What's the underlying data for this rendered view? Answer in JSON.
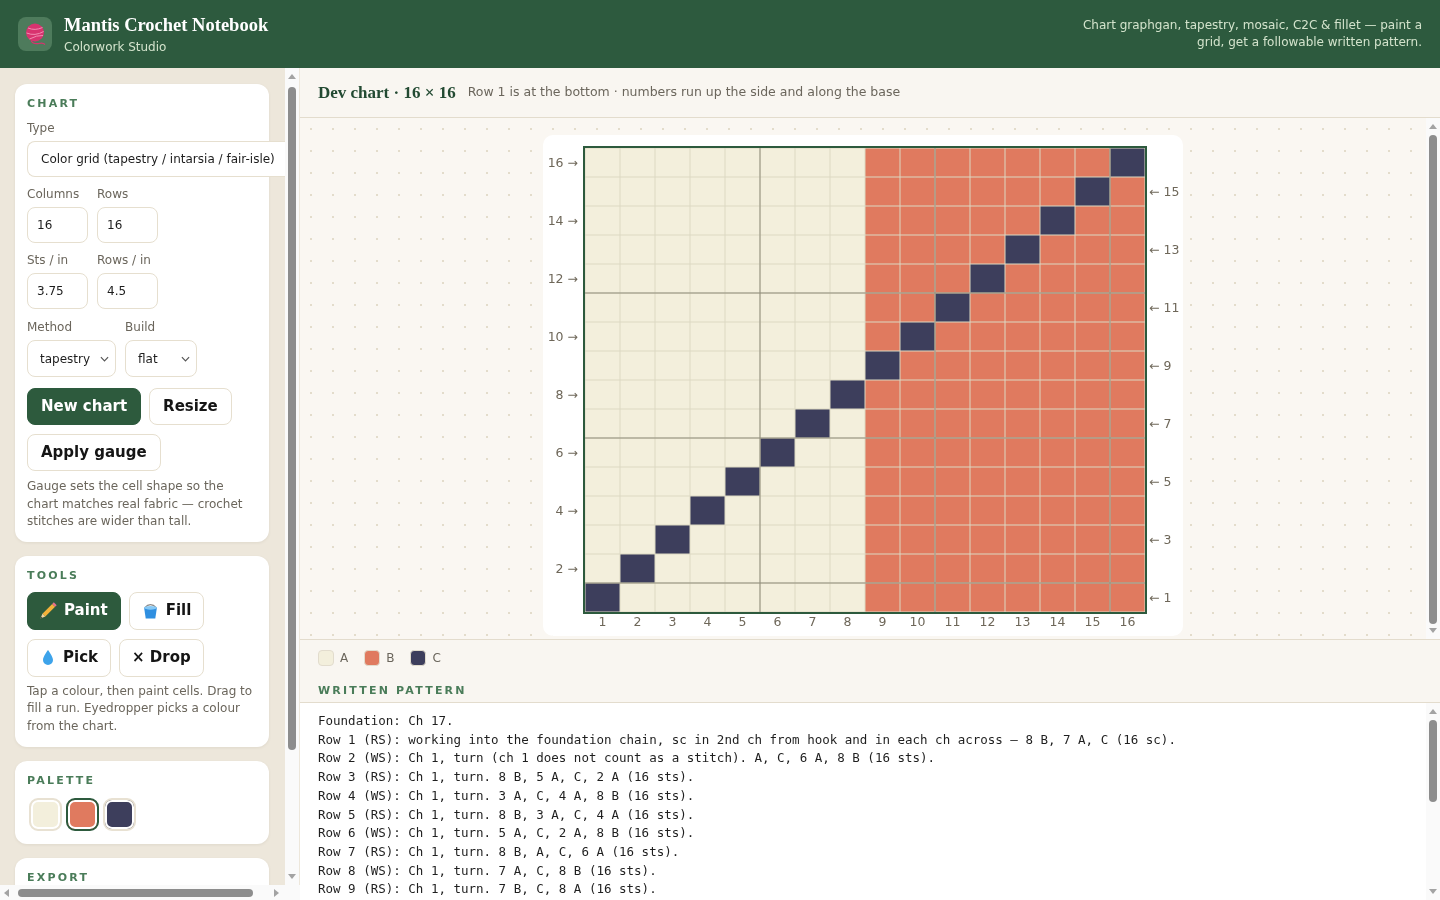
{
  "header": {
    "title": "Mantis Crochet Notebook",
    "subtitle": "Colorwork Studio",
    "tagline": "Chart graphgan, tapestry, mosaic, C2C & fillet — paint a grid, get a followable written pattern."
  },
  "sidebar": {
    "chart_panel": {
      "heading": "CHART",
      "type_field": {
        "label": "Type",
        "value": "Color grid (tapestry / intarsia / fair-isle)"
      },
      "size_fields": [
        {
          "label": "Columns",
          "value": "16"
        },
        {
          "label": "Rows",
          "value": "16"
        }
      ],
      "gauge_fields": [
        {
          "label": "Sts / in",
          "value": "3.75"
        },
        {
          "label": "Rows / in",
          "value": "4.5"
        }
      ],
      "dropdowns": [
        {
          "label": "Method",
          "value": "tapestry"
        },
        {
          "label": "Build",
          "value": "flat"
        }
      ],
      "buttons": [
        {
          "label": "New chart",
          "kind": "primary"
        },
        {
          "label": "Resize",
          "kind": "secondary"
        },
        {
          "label": "Apply gauge",
          "kind": "secondary"
        }
      ],
      "note": "Gauge sets the cell shape so the chart matches real fabric — crochet stitches are wider than tall."
    },
    "tools_panel": {
      "heading": "TOOLS",
      "tools": [
        {
          "kind": "paint",
          "label": "Paint",
          "selected": true
        },
        {
          "kind": "fill",
          "label": "Fill",
          "selected": false
        },
        {
          "kind": "pick",
          "label": "Pick",
          "selected": false
        },
        {
          "kind": "drop",
          "label": "× Drop",
          "selected": false
        }
      ],
      "note": "Tap a colour, then paint cells. Drag to fill a run. Eyedropper picks a colour from the chart."
    },
    "palette_panel": {
      "heading": "PALETTE",
      "swatches": [
        {
          "color": "#f3efdc",
          "selected": false
        },
        {
          "color": "#e07a5f",
          "selected": true
        },
        {
          "color": "#3d3e5c",
          "selected": false
        }
      ]
    },
    "export_panel": {
      "heading": "EXPORT"
    }
  },
  "chart": {
    "title": "Dev chart · 16 × 16",
    "subtitle": "Row 1 is at the bottom · numbers run up the side and along the base",
    "rows": [
      {
        "label": "16 →",
        "kind": "left",
        "cells": [
          {
            "color": "#f3efdc"
          },
          {
            "color": "#f3efdc"
          },
          {
            "color": "#f3efdc"
          },
          {
            "color": "#f3efdc"
          },
          {
            "color": "#f3efdc"
          },
          {
            "color": "#f3efdc"
          },
          {
            "color": "#f3efdc"
          },
          {
            "color": "#f3efdc"
          },
          {
            "color": "#e07a5f"
          },
          {
            "color": "#e07a5f"
          },
          {
            "color": "#e07a5f"
          },
          {
            "color": "#e07a5f"
          },
          {
            "color": "#e07a5f"
          },
          {
            "color": "#e07a5f"
          },
          {
            "color": "#e07a5f"
          },
          {
            "color": "#3d3e5c"
          }
        ]
      },
      {
        "label": "← 15",
        "kind": "right",
        "cells": [
          {
            "color": "#f3efdc"
          },
          {
            "color": "#f3efdc"
          },
          {
            "color": "#f3efdc"
          },
          {
            "color": "#f3efdc"
          },
          {
            "color": "#f3efdc"
          },
          {
            "color": "#f3efdc"
          },
          {
            "color": "#f3efdc"
          },
          {
            "color": "#f3efdc"
          },
          {
            "color": "#e07a5f"
          },
          {
            "color": "#e07a5f"
          },
          {
            "color": "#e07a5f"
          },
          {
            "color": "#e07a5f"
          },
          {
            "color": "#e07a5f"
          },
          {
            "color": "#e07a5f"
          },
          {
            "color": "#3d3e5c"
          },
          {
            "color": "#e07a5f"
          }
        ]
      },
      {
        "label": "14 →",
        "kind": "left",
        "cells": [
          {
            "color": "#f3efdc"
          },
          {
            "color": "#f3efdc"
          },
          {
            "color": "#f3efdc"
          },
          {
            "color": "#f3efdc"
          },
          {
            "color": "#f3efdc"
          },
          {
            "color": "#f3efdc"
          },
          {
            "color": "#f3efdc"
          },
          {
            "color": "#f3efdc"
          },
          {
            "color": "#e07a5f"
          },
          {
            "color": "#e07a5f"
          },
          {
            "color": "#e07a5f"
          },
          {
            "color": "#e07a5f"
          },
          {
            "color": "#e07a5f"
          },
          {
            "color": "#3d3e5c"
          },
          {
            "color": "#e07a5f"
          },
          {
            "color": "#e07a5f"
          }
        ]
      },
      {
        "label": "← 13",
        "kind": "right",
        "cells": [
          {
            "color": "#f3efdc"
          },
          {
            "color": "#f3efdc"
          },
          {
            "color": "#f3efdc"
          },
          {
            "color": "#f3efdc"
          },
          {
            "color": "#f3efdc"
          },
          {
            "color": "#f3efdc"
          },
          {
            "color": "#f3efdc"
          },
          {
            "color": "#f3efdc"
          },
          {
            "color": "#e07a5f"
          },
          {
            "color": "#e07a5f"
          },
          {
            "color": "#e07a5f"
          },
          {
            "color": "#e07a5f"
          },
          {
            "color": "#3d3e5c"
          },
          {
            "color": "#e07a5f"
          },
          {
            "color": "#e07a5f"
          },
          {
            "color": "#e07a5f"
          }
        ]
      },
      {
        "label": "12 →",
        "kind": "left",
        "cells": [
          {
            "color": "#f3efdc"
          },
          {
            "color": "#f3efdc"
          },
          {
            "color": "#f3efdc"
          },
          {
            "color": "#f3efdc"
          },
          {
            "color": "#f3efdc"
          },
          {
            "color": "#f3efdc"
          },
          {
            "color": "#f3efdc"
          },
          {
            "color": "#f3efdc"
          },
          {
            "color": "#e07a5f"
          },
          {
            "color": "#e07a5f"
          },
          {
            "color": "#e07a5f"
          },
          {
            "color": "#3d3e5c"
          },
          {
            "color": "#e07a5f"
          },
          {
            "color": "#e07a5f"
          },
          {
            "color": "#e07a5f"
          },
          {
            "color": "#e07a5f"
          }
        ]
      },
      {
        "label": "← 11",
        "kind": "right",
        "cells": [
          {
            "color": "#f3efdc"
          },
          {
            "color": "#f3efdc"
          },
          {
            "color": "#f3efdc"
          },
          {
            "color": "#f3efdc"
          },
          {
            "color": "#f3efdc"
          },
          {
            "color": "#f3efdc"
          },
          {
            "color": "#f3efdc"
          },
          {
            "color": "#f3efdc"
          },
          {
            "color": "#e07a5f"
          },
          {
            "color": "#e07a5f"
          },
          {
            "color": "#3d3e5c"
          },
          {
            "color": "#e07a5f"
          },
          {
            "color": "#e07a5f"
          },
          {
            "color": "#e07a5f"
          },
          {
            "color": "#e07a5f"
          },
          {
            "color": "#e07a5f"
          }
        ]
      },
      {
        "label": "10 →",
        "kind": "left",
        "cells": [
          {
            "color": "#f3efdc"
          },
          {
            "color": "#f3efdc"
          },
          {
            "color": "#f3efdc"
          },
          {
            "color": "#f3efdc"
          },
          {
            "color": "#f3efdc"
          },
          {
            "color": "#f3efdc"
          },
          {
            "color": "#f3efdc"
          },
          {
            "color": "#f3efdc"
          },
          {
            "color": "#e07a5f"
          },
          {
            "color": "#3d3e5c"
          },
          {
            "color": "#e07a5f"
          },
          {
            "color": "#e07a5f"
          },
          {
            "color": "#e07a5f"
          },
          {
            "color": "#e07a5f"
          },
          {
            "color": "#e07a5f"
          },
          {
            "color": "#e07a5f"
          }
        ]
      },
      {
        "label": "← 9",
        "kind": "right",
        "cells": [
          {
            "color": "#f3efdc"
          },
          {
            "color": "#f3efdc"
          },
          {
            "color": "#f3efdc"
          },
          {
            "color": "#f3efdc"
          },
          {
            "color": "#f3efdc"
          },
          {
            "color": "#f3efdc"
          },
          {
            "color": "#f3efdc"
          },
          {
            "color": "#f3efdc"
          },
          {
            "color": "#3d3e5c"
          },
          {
            "color": "#e07a5f"
          },
          {
            "color": "#e07a5f"
          },
          {
            "color": "#e07a5f"
          },
          {
            "color": "#e07a5f"
          },
          {
            "color": "#e07a5f"
          },
          {
            "color": "#e07a5f"
          },
          {
            "color": "#e07a5f"
          }
        ]
      },
      {
        "label": "8 →",
        "kind": "left",
        "cells": [
          {
            "color": "#f3efdc"
          },
          {
            "color": "#f3efdc"
          },
          {
            "color": "#f3efdc"
          },
          {
            "color": "#f3efdc"
          },
          {
            "color": "#f3efdc"
          },
          {
            "color": "#f3efdc"
          },
          {
            "color": "#f3efdc"
          },
          {
            "color": "#3d3e5c"
          },
          {
            "color": "#e07a5f"
          },
          {
            "color": "#e07a5f"
          },
          {
            "color": "#e07a5f"
          },
          {
            "color": "#e07a5f"
          },
          {
            "color": "#e07a5f"
          },
          {
            "color": "#e07a5f"
          },
          {
            "color": "#e07a5f"
          },
          {
            "color": "#e07a5f"
          }
        ]
      },
      {
        "label": "← 7",
        "kind": "right",
        "cells": [
          {
            "color": "#f3efdc"
          },
          {
            "color": "#f3efdc"
          },
          {
            "color": "#f3efdc"
          },
          {
            "color": "#f3efdc"
          },
          {
            "color": "#f3efdc"
          },
          {
            "color": "#f3efdc"
          },
          {
            "color": "#3d3e5c"
          },
          {
            "color": "#f3efdc"
          },
          {
            "color": "#e07a5f"
          },
          {
            "color": "#e07a5f"
          },
          {
            "color": "#e07a5f"
          },
          {
            "color": "#e07a5f"
          },
          {
            "color": "#e07a5f"
          },
          {
            "color": "#e07a5f"
          },
          {
            "color": "#e07a5f"
          },
          {
            "color": "#e07a5f"
          }
        ]
      },
      {
        "label": "6 →",
        "kind": "left",
        "cells": [
          {
            "color": "#f3efdc"
          },
          {
            "color": "#f3efdc"
          },
          {
            "color": "#f3efdc"
          },
          {
            "color": "#f3efdc"
          },
          {
            "color": "#f3efdc"
          },
          {
            "color": "#3d3e5c"
          },
          {
            "color": "#f3efdc"
          },
          {
            "color": "#f3efdc"
          },
          {
            "color": "#e07a5f"
          },
          {
            "color": "#e07a5f"
          },
          {
            "color": "#e07a5f"
          },
          {
            "color": "#e07a5f"
          },
          {
            "color": "#e07a5f"
          },
          {
            "color": "#e07a5f"
          },
          {
            "color": "#e07a5f"
          },
          {
            "color": "#e07a5f"
          }
        ]
      },
      {
        "label": "← 5",
        "kind": "right",
        "cells": [
          {
            "color": "#f3efdc"
          },
          {
            "color": "#f3efdc"
          },
          {
            "color": "#f3efdc"
          },
          {
            "color": "#f3efdc"
          },
          {
            "color": "#3d3e5c"
          },
          {
            "color": "#f3efdc"
          },
          {
            "color": "#f3efdc"
          },
          {
            "color": "#f3efdc"
          },
          {
            "color": "#e07a5f"
          },
          {
            "color": "#e07a5f"
          },
          {
            "color": "#e07a5f"
          },
          {
            "color": "#e07a5f"
          },
          {
            "color": "#e07a5f"
          },
          {
            "color": "#e07a5f"
          },
          {
            "color": "#e07a5f"
          },
          {
            "color": "#e07a5f"
          }
        ]
      },
      {
        "label": "4 →",
        "kind": "left",
        "cells": [
          {
            "color": "#f3efdc"
          },
          {
            "color": "#f3efdc"
          },
          {
            "color": "#f3efdc"
          },
          {
            "color": "#3d3e5c"
          },
          {
            "color": "#f3efdc"
          },
          {
            "color": "#f3efdc"
          },
          {
            "color": "#f3efdc"
          },
          {
            "color": "#f3efdc"
          },
          {
            "color": "#e07a5f"
          },
          {
            "color": "#e07a5f"
          },
          {
            "color": "#e07a5f"
          },
          {
            "color": "#e07a5f"
          },
          {
            "color": "#e07a5f"
          },
          {
            "color": "#e07a5f"
          },
          {
            "color": "#e07a5f"
          },
          {
            "color": "#e07a5f"
          }
        ]
      },
      {
        "label": "← 3",
        "kind": "right",
        "cells": [
          {
            "color": "#f3efdc"
          },
          {
            "color": "#f3efdc"
          },
          {
            "color": "#3d3e5c"
          },
          {
            "color": "#f3efdc"
          },
          {
            "color": "#f3efdc"
          },
          {
            "color": "#f3efdc"
          },
          {
            "color": "#f3efdc"
          },
          {
            "color": "#f3efdc"
          },
          {
            "color": "#e07a5f"
          },
          {
            "color": "#e07a5f"
          },
          {
            "color": "#e07a5f"
          },
          {
            "color": "#e07a5f"
          },
          {
            "color": "#e07a5f"
          },
          {
            "color": "#e07a5f"
          },
          {
            "color": "#e07a5f"
          },
          {
            "color": "#e07a5f"
          }
        ]
      },
      {
        "label": "2 →",
        "kind": "left",
        "cells": [
          {
            "color": "#f3efdc"
          },
          {
            "color": "#3d3e5c"
          },
          {
            "color": "#f3efdc"
          },
          {
            "color": "#f3efdc"
          },
          {
            "color": "#f3efdc"
          },
          {
            "color": "#f3efdc"
          },
          {
            "color": "#f3efdc"
          },
          {
            "color": "#f3efdc"
          },
          {
            "color": "#e07a5f"
          },
          {
            "color": "#e07a5f"
          },
          {
            "color": "#e07a5f"
          },
          {
            "color": "#e07a5f"
          },
          {
            "color": "#e07a5f"
          },
          {
            "color": "#e07a5f"
          },
          {
            "color": "#e07a5f"
          },
          {
            "color": "#e07a5f"
          }
        ]
      },
      {
        "label": "← 1",
        "kind": "right",
        "cells": [
          {
            "color": "#3d3e5c"
          },
          {
            "color": "#f3efdc"
          },
          {
            "color": "#f3efdc"
          },
          {
            "color": "#f3efdc"
          },
          {
            "color": "#f3efdc"
          },
          {
            "color": "#f3efdc"
          },
          {
            "color": "#f3efdc"
          },
          {
            "color": "#f3efdc"
          },
          {
            "color": "#e07a5f"
          },
          {
            "color": "#e07a5f"
          },
          {
            "color": "#e07a5f"
          },
          {
            "color": "#e07a5f"
          },
          {
            "color": "#e07a5f"
          },
          {
            "color": "#e07a5f"
          },
          {
            "color": "#e07a5f"
          },
          {
            "color": "#e07a5f"
          }
        ]
      }
    ],
    "columns": [
      "1",
      "2",
      "3",
      "4",
      "5",
      "6",
      "7",
      "8",
      "9",
      "10",
      "11",
      "12",
      "13",
      "14",
      "15",
      "16"
    ],
    "legend": [
      {
        "label": "A",
        "color": "#f3efdc"
      },
      {
        "label": "B",
        "color": "#e07a5f"
      },
      {
        "label": "C",
        "color": "#3d3e5c"
      }
    ]
  },
  "written_pattern": {
    "heading": "WRITTEN PATTERN",
    "lines": [
      "Foundation: Ch 17.",
      "Row 1 (RS): working into the foundation chain, sc in 2nd ch from hook and in each ch across — 8 B, 7 A, C (16 sc).",
      "Row 2 (WS): Ch 1, turn (ch 1 does not count as a stitch). A, C, 6 A, 8 B (16 sts).",
      "Row 3 (RS): Ch 1, turn. 8 B, 5 A, C, 2 A (16 sts).",
      "Row 4 (WS): Ch 1, turn. 3 A, C, 4 A, 8 B (16 sts).",
      "Row 5 (RS): Ch 1, turn. 8 B, 3 A, C, 4 A (16 sts).",
      "Row 6 (WS): Ch 1, turn. 5 A, C, 2 A, 8 B (16 sts).",
      "Row 7 (RS): Ch 1, turn. 8 B, A, C, 6 A (16 sts).",
      "Row 8 (WS): Ch 1, turn. 7 A, C, 8 B (16 sts).",
      "Row 9 (RS): Ch 1, turn. 7 B, C, 8 A (16 sts)."
    ]
  }
}
